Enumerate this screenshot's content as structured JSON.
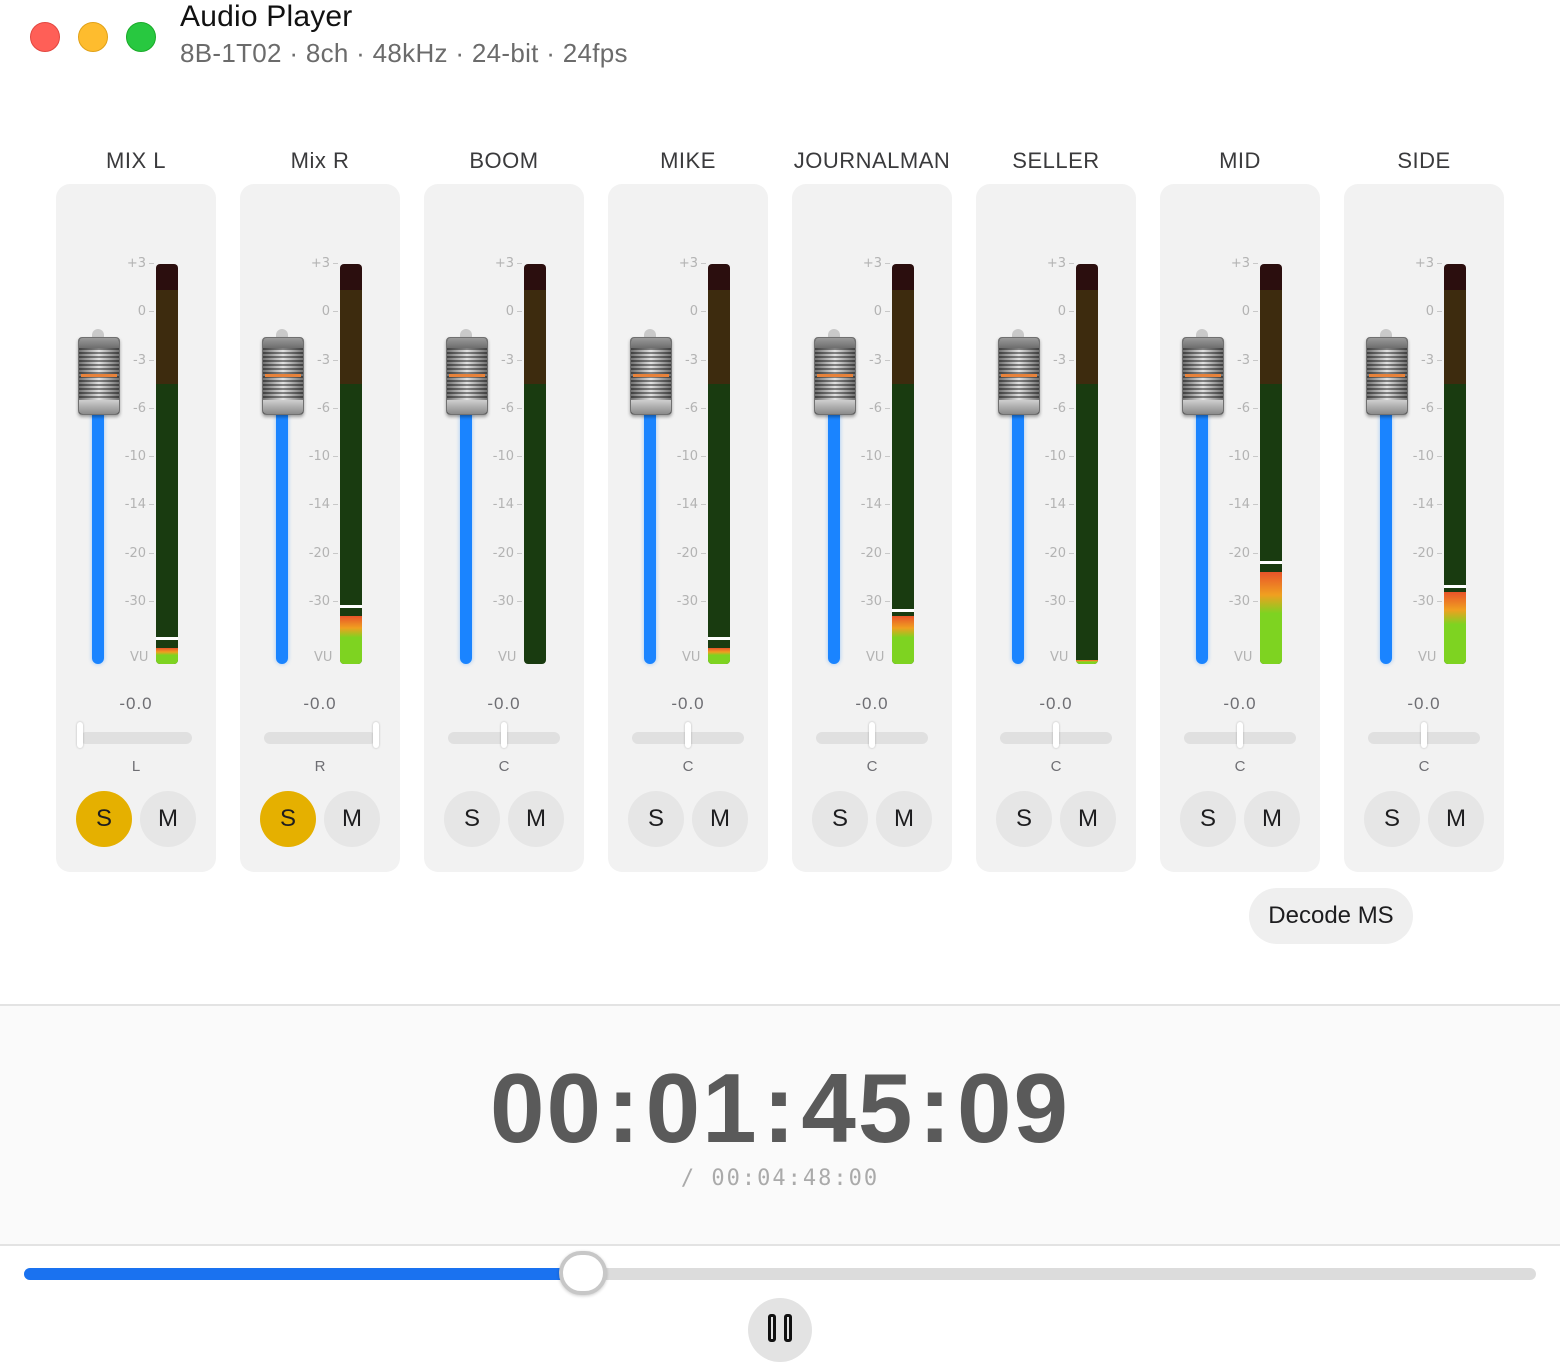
{
  "window": {
    "title": "Audio Player",
    "subtitle": "8B-1T02 · 8ch · 48kHz · 24-bit · 24fps"
  },
  "meter_scale": [
    "+3",
    "0",
    "-3",
    "-6",
    "-10",
    "-14",
    "-20",
    "-30"
  ],
  "meter_scale_bottom": "VU",
  "colors": {
    "fader_track": "#1a84ff",
    "solo_active": "#e5b000",
    "seek_fill": "#1a72f0"
  },
  "channels": [
    {
      "name": "MIX L",
      "level": "-0.0",
      "pan": "L",
      "solo": "S",
      "mute": "M",
      "solo_on": true,
      "meter_fill": 0.04,
      "meter_peak": 0.06
    },
    {
      "name": "Mix R",
      "level": "-0.0",
      "pan": "R",
      "solo": "S",
      "mute": "M",
      "solo_on": true,
      "meter_fill": 0.12,
      "meter_peak": 0.14
    },
    {
      "name": "BOOM",
      "level": "-0.0",
      "pan": "C",
      "solo": "S",
      "mute": "M",
      "solo_on": false,
      "meter_fill": 0.0,
      "meter_peak": null
    },
    {
      "name": "MIKE",
      "level": "-0.0",
      "pan": "C",
      "solo": "S",
      "mute": "M",
      "solo_on": false,
      "meter_fill": 0.04,
      "meter_peak": 0.06
    },
    {
      "name": "JOURNALMAN",
      "level": "-0.0",
      "pan": "C",
      "solo": "S",
      "mute": "M",
      "solo_on": false,
      "meter_fill": 0.12,
      "meter_peak": 0.13
    },
    {
      "name": "SELLER",
      "level": "-0.0",
      "pan": "C",
      "solo": "S",
      "mute": "M",
      "solo_on": false,
      "meter_fill": 0.01,
      "meter_peak": null
    },
    {
      "name": "MID",
      "level": "-0.0",
      "pan": "C",
      "solo": "S",
      "mute": "M",
      "solo_on": false,
      "meter_fill": 0.23,
      "meter_peak": 0.25
    },
    {
      "name": "SIDE",
      "level": "-0.0",
      "pan": "C",
      "solo": "S",
      "mute": "M",
      "solo_on": false,
      "meter_fill": 0.18,
      "meter_peak": 0.19
    }
  ],
  "decode_button": "Decode MS",
  "transport": {
    "time": {
      "hh": "00",
      "mm": "01",
      "ss": "45",
      "ff": "09"
    },
    "separator": ":",
    "duration": "/  00:04:48:00",
    "progress": 0.37
  }
}
